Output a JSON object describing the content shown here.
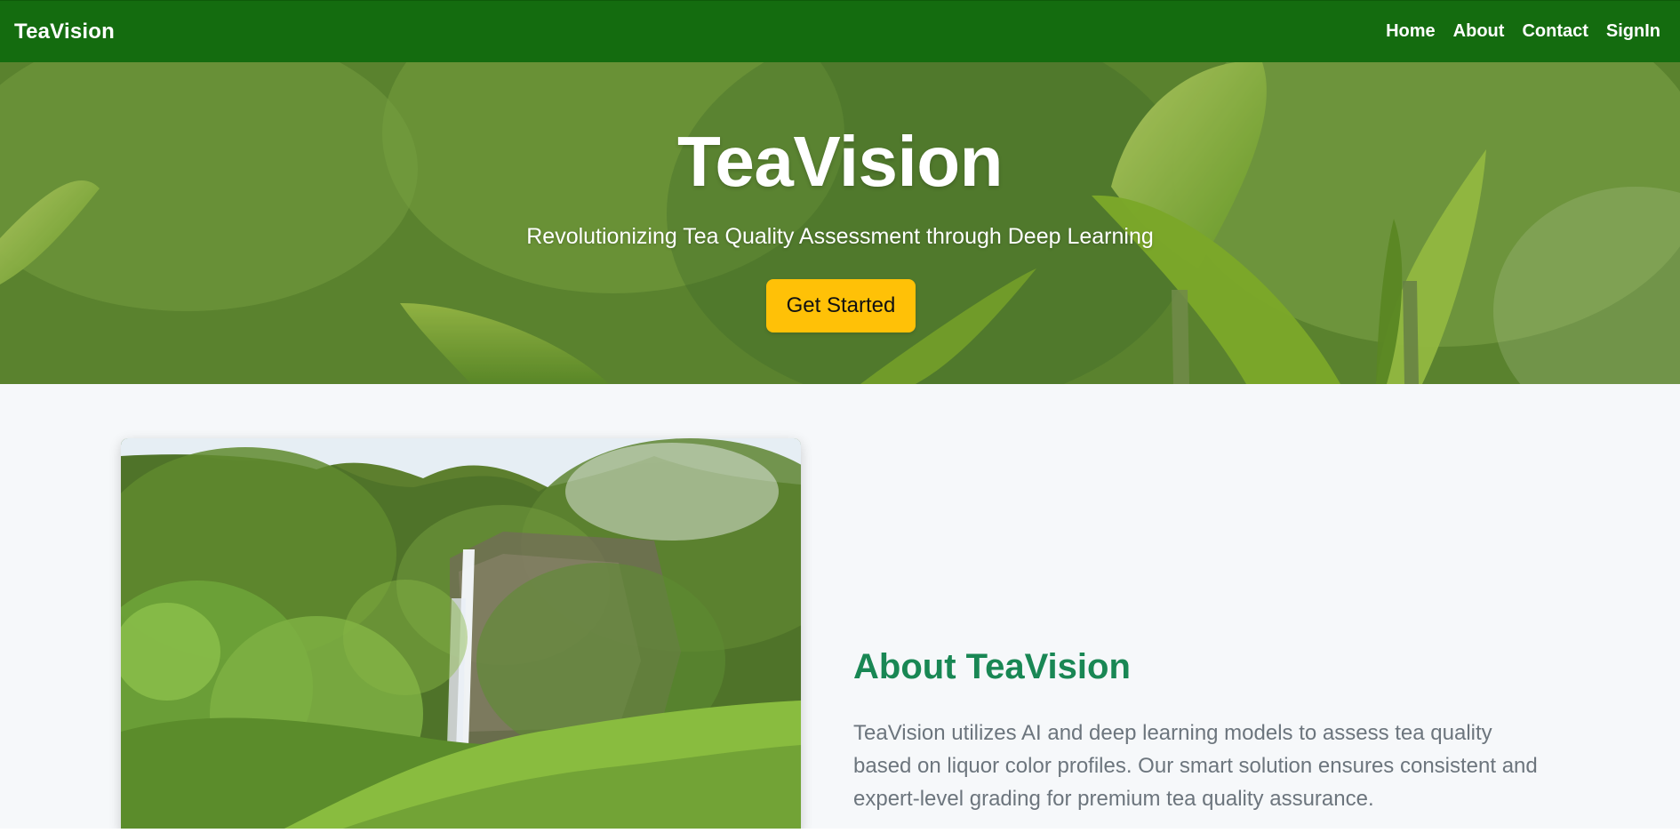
{
  "nav": {
    "brand": "TeaVision",
    "links": [
      {
        "label": "Home"
      },
      {
        "label": "About"
      },
      {
        "label": "Contact"
      },
      {
        "label": "SignIn"
      }
    ],
    "background_color": "#146c0f"
  },
  "hero": {
    "title": "TeaVision",
    "subtitle": "Revolutionizing Tea Quality Assessment through Deep Learning",
    "cta_label": "Get Started",
    "cta_color": "#ffc107"
  },
  "about": {
    "image_alt": "Waterfall over tea plantation hillside",
    "title": "About TeaVision",
    "title_color": "#198754",
    "text": "TeaVision utilizes AI and deep learning models to assess tea quality based on liquor color profiles. Our smart solution ensures consistent and expert-level grading for premium tea quality assurance."
  }
}
